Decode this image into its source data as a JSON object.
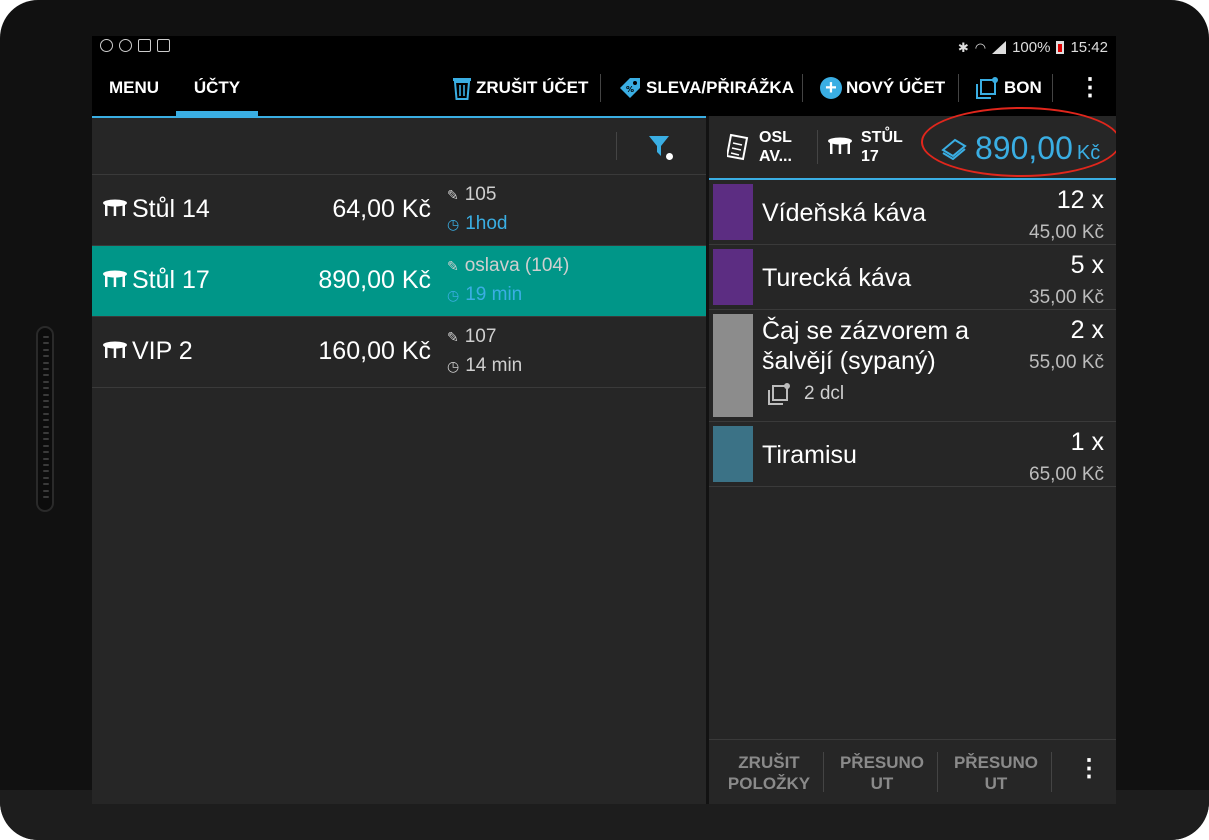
{
  "status": {
    "battery": "100%",
    "time": "15:42"
  },
  "actionbar": {
    "tab_menu": "MENU",
    "tab_accounts": "ÚČTY",
    "cancel_account": "ZRUŠIT ÚČET",
    "discount": "SLEVA/PŘIRÁŽKA",
    "new_account": "NOVÝ ÚČET",
    "bon": "BON"
  },
  "accounts": [
    {
      "name": "Stůl 14",
      "price": "64,00 Kč",
      "note": "105",
      "time": "1hod",
      "time_color": "#3aaee3"
    },
    {
      "name": "Stůl 17",
      "price": "890,00 Kč",
      "note": "oslava (104)",
      "time": "19 min",
      "time_color": "#3aaee3",
      "selected": true
    },
    {
      "name": "VIP 2",
      "price": "160,00 Kč",
      "note": "107",
      "time": "14 min",
      "time_color": "#cfcfcf"
    }
  ],
  "detail": {
    "note": "OSL\nAV...",
    "note_l1": "OSL",
    "note_l2": "AV...",
    "table_l1": "STŮL",
    "table_l2": "17",
    "total": "890,00",
    "currency": "Kč"
  },
  "items": [
    {
      "name": "Vídeňská káva",
      "qty": "12 x",
      "price": "45,00 Kč",
      "color": "#5c2d82"
    },
    {
      "name": "Turecká káva",
      "qty": "5 x",
      "price": "35,00 Kč",
      "color": "#5c2d82"
    },
    {
      "name_l1": "Čaj se zázvorem a",
      "name_l2": "šalvějí (sypaný)",
      "qty": "2 x",
      "price": "55,00 Kč",
      "sub": "2 dcl",
      "color": "#8c8c8c"
    },
    {
      "name": "Tiramisu",
      "qty": "1 x",
      "price": "65,00 Kč",
      "color": "#3b7286"
    }
  ],
  "bottom": {
    "cancel_items_l1": "ZRUŠIT",
    "cancel_items_l2": "POLOŽKY",
    "move1_l1": "PŘESUNO",
    "move1_l2": "UT",
    "move2_l1": "PŘESUNO",
    "move2_l2": "UT"
  },
  "colors": {
    "accent": "#3aaee3",
    "selected_row": "#009688",
    "highlight_circle": "#e0261c"
  }
}
